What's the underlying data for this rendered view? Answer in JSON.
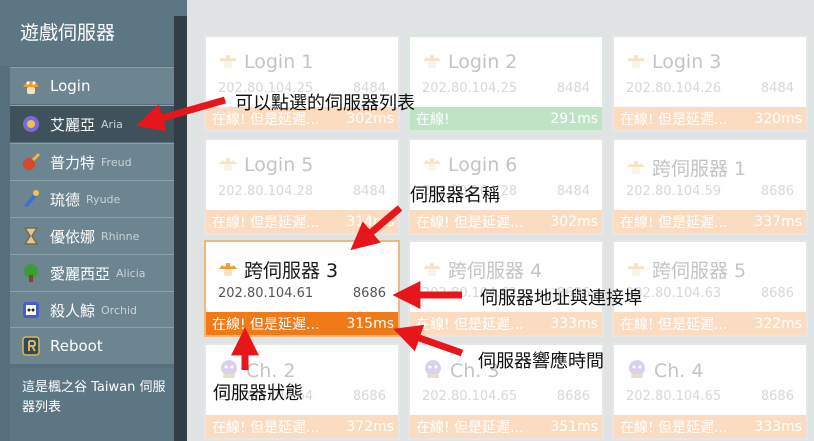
{
  "sidebar": {
    "title": "遊戲伺服器",
    "items": [
      {
        "label": "Login",
        "sub": "",
        "icon": "mushroom-icon"
      },
      {
        "label": "艾麗亞",
        "sub": "Aria",
        "icon": "aria-world-icon"
      },
      {
        "label": "普力特",
        "sub": "Freud",
        "icon": "freud-world-icon"
      },
      {
        "label": "琉德",
        "sub": "Ryude",
        "icon": "ryude-world-icon"
      },
      {
        "label": "優依娜",
        "sub": "Rhinne",
        "icon": "rhinne-world-icon"
      },
      {
        "label": "愛麗西亞",
        "sub": "Alicia",
        "icon": "alicia-world-icon"
      },
      {
        "label": "殺人鯨",
        "sub": "Orchid",
        "icon": "orchid-world-icon"
      },
      {
        "label": "Reboot",
        "sub": "",
        "icon": "reboot-icon"
      }
    ],
    "footer": "這是楓之谷 Taiwan 伺服器列表"
  },
  "servers": [
    {
      "name": "Login 1",
      "address": "202.80.104.25",
      "port": "8484",
      "status": "在線! 但是延遲...",
      "latency": "302ms"
    },
    {
      "name": "Login 2",
      "address": "202.80.104.25",
      "port": "8484",
      "status": "在線!",
      "latency": "291ms"
    },
    {
      "name": "Login 3",
      "address": "202.80.104.26",
      "port": "8484",
      "status": "在線! 但是延遲...",
      "latency": "320ms"
    },
    {
      "name": "Login 5",
      "address": "202.80.104.28",
      "port": "8484",
      "status": "在線! 但是延遲...",
      "latency": "314ms"
    },
    {
      "name": "Login 6",
      "address": "202.80.104.28",
      "port": "8484",
      "status": "在線! 但是延遲...",
      "latency": "302ms"
    },
    {
      "name": "跨伺服器 1",
      "address": "202.80.104.59",
      "port": "8686",
      "status": "在線! 但是延遲...",
      "latency": "337ms"
    },
    {
      "name": "跨伺服器 3",
      "address": "202.80.104.61",
      "port": "8686",
      "status": "在線! 但是延遲...",
      "latency": "315ms"
    },
    {
      "name": "跨伺服器 4",
      "address": "202.80.104.62",
      "port": "8686",
      "status": "在線! 但是延遲...",
      "latency": "333ms"
    },
    {
      "name": "跨伺服器 5",
      "address": "202.80.104.63",
      "port": "8686",
      "status": "在線! 但是延遲...",
      "latency": "322ms"
    },
    {
      "name": "Ch. 2",
      "address": "202.80.104.64",
      "port": "8686",
      "status": "在線! 但是延遲...",
      "latency": "372ms"
    },
    {
      "name": "Ch. 3",
      "address": "202.80.104.65",
      "port": "8686",
      "status": "在線! 但是延遲...",
      "latency": "351ms"
    },
    {
      "name": "Ch. 4",
      "address": "202.80.104.65",
      "port": "8686",
      "status": "在線! 但是延遲...",
      "latency": "333ms"
    }
  ],
  "annotations": {
    "list": "可以點選的伺服器列表",
    "name": "伺服器名稱",
    "address": "伺服器地址與連接埠",
    "latency": "伺服器響應時間",
    "status": "伺服器狀態"
  },
  "colors": {
    "sidebar": "#57707d",
    "status_delayed": "#f07918",
    "status_online": "#bfe3c4",
    "arrow": "#e8161b"
  }
}
